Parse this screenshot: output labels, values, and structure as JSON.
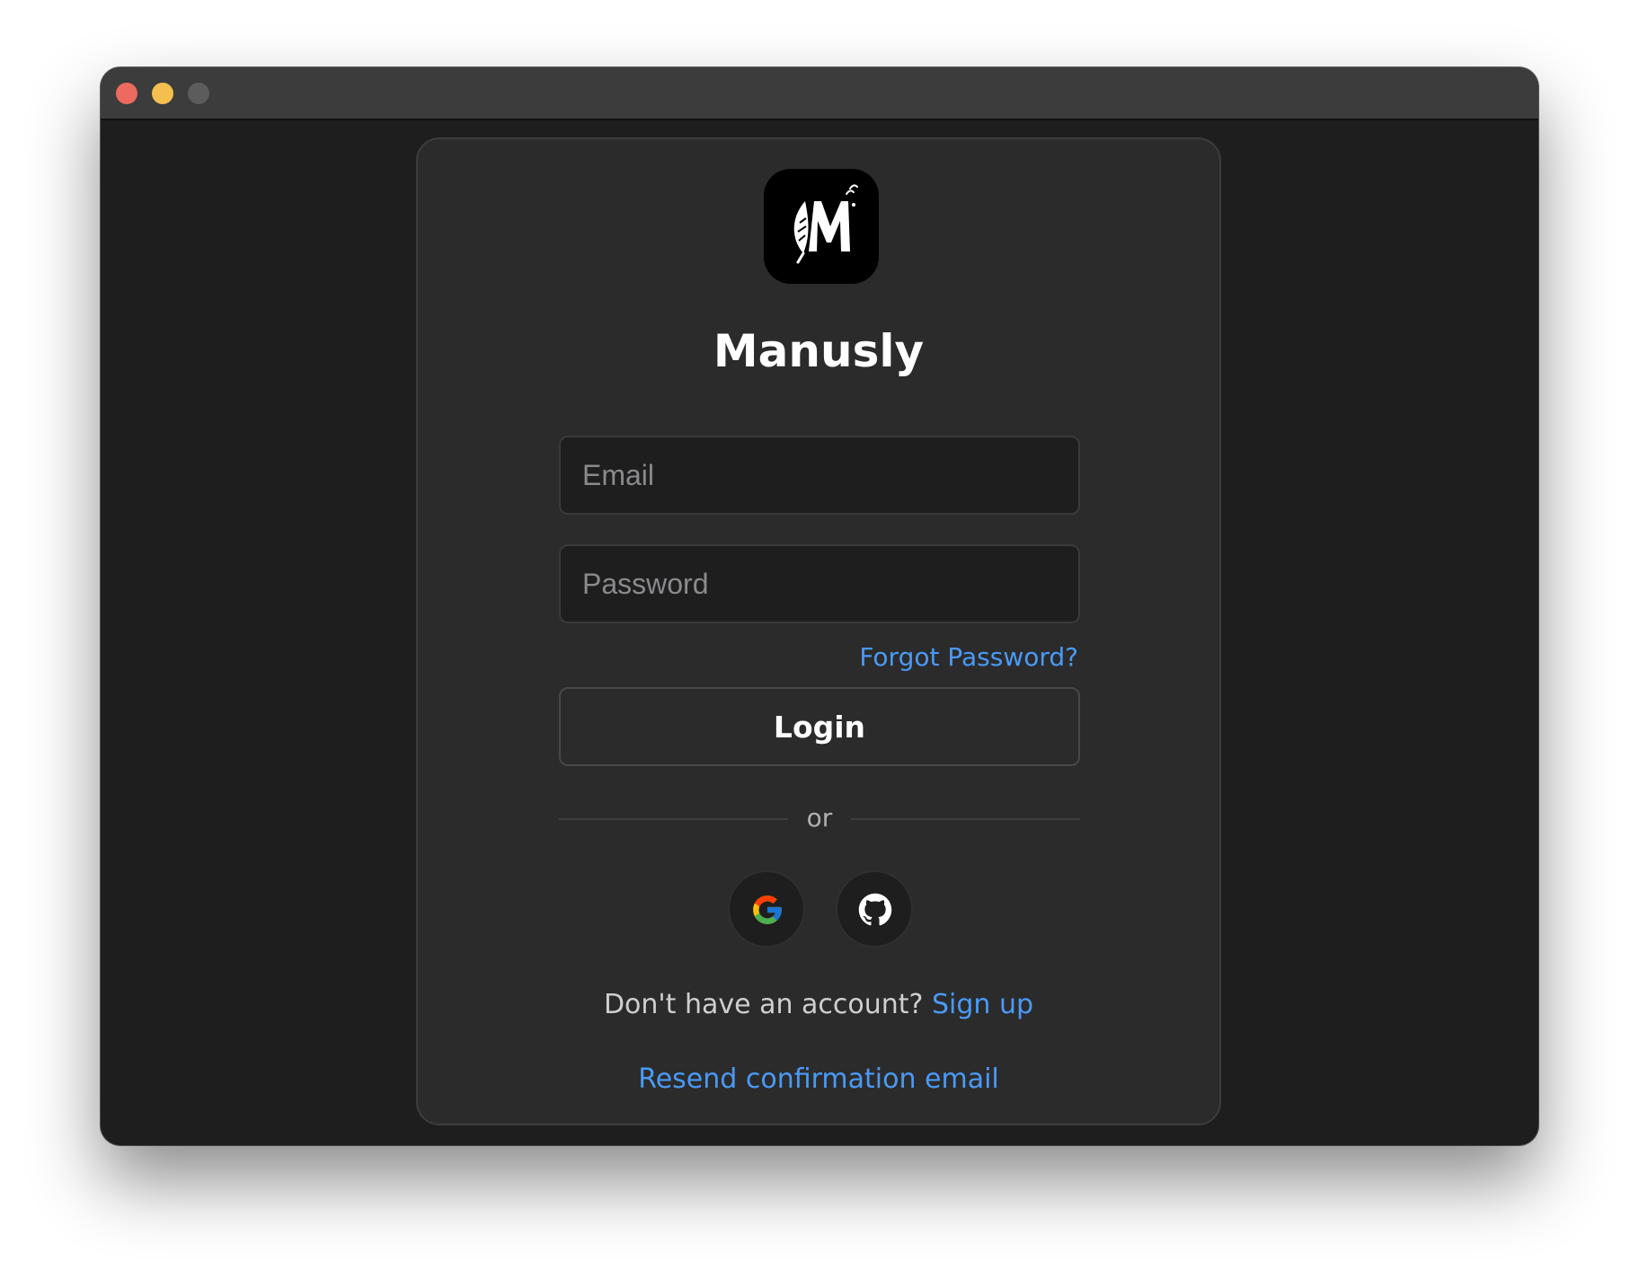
{
  "window": {
    "traffic_lights": {
      "close_color": "#ec6a5e",
      "minimize_color": "#f4bf4f",
      "zoom_color": "#5c5c5c"
    }
  },
  "app": {
    "name": "Manusly",
    "logo_icon": "manusly-logo-icon"
  },
  "form": {
    "email_placeholder": "Email",
    "password_placeholder": "Password",
    "forgot_password_label": "Forgot Password?",
    "login_label": "Login",
    "divider_label": "or"
  },
  "social": {
    "google_icon": "google-icon",
    "github_icon": "github-icon"
  },
  "footer": {
    "signup_prompt": "Don't have an account? ",
    "signup_link": "Sign up",
    "resend_link": "Resend confirmation email"
  },
  "colors": {
    "accent": "#4a9af5",
    "window_bg": "#1e1e1e",
    "card_bg": "#2b2b2c"
  }
}
